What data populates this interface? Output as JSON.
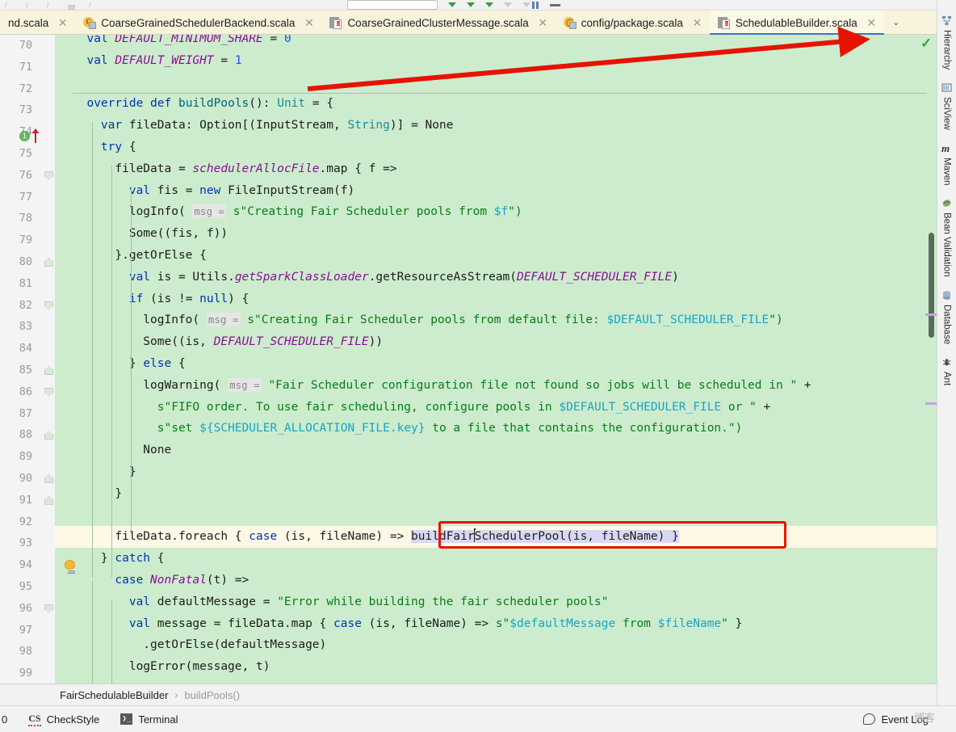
{
  "window": {
    "title": "SchedulableBuilder.scala"
  },
  "toolbar": {
    "search_placeholder": ""
  },
  "tabs": [
    {
      "label": "nd.scala",
      "icon": "scala-file-icon",
      "active": false,
      "truncated": true
    },
    {
      "label": "CoarseGrainedSchedulerBackend.scala",
      "icon": "scala-class-icon",
      "active": false
    },
    {
      "label": "CoarseGrainedClusterMessage.scala",
      "icon": "scala-file-icon",
      "active": false
    },
    {
      "label": "config/package.scala",
      "icon": "scala-package-icon",
      "active": false
    },
    {
      "label": "SchedulableBuilder.scala",
      "icon": "scala-file-icon",
      "active": true
    }
  ],
  "tab_overflow_label": "⌄",
  "editor": {
    "first_line": 70,
    "highlighted_line": 93,
    "caret_line": 93,
    "lines": [
      {
        "n": 70,
        "clipped": true,
        "tokens": [
          {
            "t": "  ",
            "c": ""
          },
          {
            "t": "val",
            "c": "kw"
          },
          {
            "t": " ",
            "c": ""
          },
          {
            "t": "DEFAULT_MINIMUM_SHARE",
            "c": "const"
          },
          {
            "t": " = ",
            "c": ""
          },
          {
            "t": "0",
            "c": "num"
          }
        ]
      },
      {
        "n": 71,
        "tokens": [
          {
            "t": "  ",
            "c": ""
          },
          {
            "t": "val",
            "c": "kw"
          },
          {
            "t": " ",
            "c": ""
          },
          {
            "t": "DEFAULT_WEIGHT",
            "c": "const"
          },
          {
            "t": " = ",
            "c": ""
          },
          {
            "t": "1",
            "c": "num"
          }
        ]
      },
      {
        "n": 72,
        "tokens": []
      },
      {
        "n": 73,
        "sep": true,
        "marker": "override-marker",
        "tokens": [
          {
            "t": "  ",
            "c": ""
          },
          {
            "t": "override",
            "c": "kw"
          },
          {
            "t": " ",
            "c": ""
          },
          {
            "t": "def",
            "c": "kw"
          },
          {
            "t": " ",
            "c": ""
          },
          {
            "t": "buildPools",
            "c": "fn"
          },
          {
            "t": "(): ",
            "c": ""
          },
          {
            "t": "Unit",
            "c": "type"
          },
          {
            "t": " = {",
            "c": ""
          }
        ]
      },
      {
        "n": 74,
        "tokens": [
          {
            "t": "    ",
            "c": ""
          },
          {
            "t": "var",
            "c": "kw"
          },
          {
            "t": " fileData: Option[(InputStream, ",
            "c": ""
          },
          {
            "t": "String",
            "c": "type"
          },
          {
            "t": ")] = None",
            "c": ""
          }
        ]
      },
      {
        "n": 75,
        "tokens": [
          {
            "t": "    ",
            "c": ""
          },
          {
            "t": "try",
            "c": "kw"
          },
          {
            "t": " {",
            "c": ""
          }
        ]
      },
      {
        "n": 76,
        "fold": "down",
        "tokens": [
          {
            "t": "      fileData = ",
            "c": ""
          },
          {
            "t": "schedulerAllocFile",
            "c": "italicv"
          },
          {
            "t": ".map { f =>",
            "c": ""
          }
        ]
      },
      {
        "n": 77,
        "tokens": [
          {
            "t": "        ",
            "c": ""
          },
          {
            "t": "val",
            "c": "kw"
          },
          {
            "t": " fis = ",
            "c": ""
          },
          {
            "t": "new",
            "c": "kw"
          },
          {
            "t": " FileInputStream(f)",
            "c": ""
          }
        ]
      },
      {
        "n": 78,
        "tokens": [
          {
            "t": "        logInfo( ",
            "c": ""
          },
          {
            "t": "msg =",
            "c": "hint"
          },
          {
            "t": " ",
            "c": ""
          },
          {
            "t": "s\"Creating Fair Scheduler pools from ",
            "c": "str"
          },
          {
            "t": "$f",
            "c": "dollar"
          },
          {
            "t": "\")",
            "c": "str"
          }
        ]
      },
      {
        "n": 79,
        "tokens": [
          {
            "t": "        Some((fis, f))",
            "c": ""
          }
        ]
      },
      {
        "n": 80,
        "fold": "up",
        "tokens": [
          {
            "t": "      }.getOrElse {",
            "c": ""
          }
        ]
      },
      {
        "n": 81,
        "tokens": [
          {
            "t": "        ",
            "c": ""
          },
          {
            "t": "val",
            "c": "kw"
          },
          {
            "t": " is = Utils.",
            "c": ""
          },
          {
            "t": "getSparkClassLoader",
            "c": "italicv"
          },
          {
            "t": ".getResourceAsStream(",
            "c": ""
          },
          {
            "t": "DEFAULT_SCHEDULER_FILE",
            "c": "const"
          },
          {
            "t": ")",
            "c": ""
          }
        ]
      },
      {
        "n": 82,
        "fold": "down",
        "tokens": [
          {
            "t": "        ",
            "c": ""
          },
          {
            "t": "if",
            "c": "kw"
          },
          {
            "t": " (is != ",
            "c": ""
          },
          {
            "t": "null",
            "c": "kw"
          },
          {
            "t": ") {",
            "c": ""
          }
        ]
      },
      {
        "n": 83,
        "tokens": [
          {
            "t": "          logInfo( ",
            "c": ""
          },
          {
            "t": "msg =",
            "c": "hint"
          },
          {
            "t": " ",
            "c": ""
          },
          {
            "t": "s\"Creating Fair Scheduler pools from default file: ",
            "c": "str"
          },
          {
            "t": "$DEFAULT_SCHEDULER_FILE",
            "c": "dollar"
          },
          {
            "t": "\")",
            "c": "str"
          }
        ]
      },
      {
        "n": 84,
        "tokens": [
          {
            "t": "          Some((is, ",
            "c": ""
          },
          {
            "t": "DEFAULT_SCHEDULER_FILE",
            "c": "const"
          },
          {
            "t": "))",
            "c": ""
          }
        ]
      },
      {
        "n": 85,
        "fold": "up",
        "tokens": [
          {
            "t": "        } ",
            "c": ""
          },
          {
            "t": "else",
            "c": "kw"
          },
          {
            "t": " {",
            "c": ""
          }
        ]
      },
      {
        "n": 86,
        "fold": "down",
        "tokens": [
          {
            "t": "          logWarning( ",
            "c": ""
          },
          {
            "t": "msg =",
            "c": "hint"
          },
          {
            "t": " ",
            "c": ""
          },
          {
            "t": "\"Fair Scheduler configuration file not found so jobs will be scheduled in \"",
            "c": "str"
          },
          {
            "t": " +",
            "c": ""
          }
        ]
      },
      {
        "n": 87,
        "tokens": [
          {
            "t": "            ",
            "c": ""
          },
          {
            "t": "s\"FIFO order. To use fair scheduling, configure pools in ",
            "c": "str"
          },
          {
            "t": "$DEFAULT_SCHEDULER_FILE",
            "c": "dollar"
          },
          {
            "t": " or \"",
            "c": "str"
          },
          {
            "t": " +",
            "c": ""
          }
        ]
      },
      {
        "n": 88,
        "fold": "up",
        "tokens": [
          {
            "t": "            ",
            "c": ""
          },
          {
            "t": "s\"set ",
            "c": "str"
          },
          {
            "t": "${SCHEDULER_ALLOCATION_FILE.key}",
            "c": "dollar"
          },
          {
            "t": " to a file that contains the configuration.\")",
            "c": "str"
          }
        ]
      },
      {
        "n": 89,
        "tokens": [
          {
            "t": "          None",
            "c": ""
          }
        ]
      },
      {
        "n": 90,
        "fold": "up",
        "tokens": [
          {
            "t": "        }",
            "c": ""
          }
        ]
      },
      {
        "n": 91,
        "fold": "up",
        "tokens": [
          {
            "t": "      }",
            "c": ""
          }
        ]
      },
      {
        "n": 92,
        "tokens": []
      },
      {
        "n": 93,
        "highlight": true,
        "bulb": true,
        "tokens": [
          {
            "t": "      fileData.foreach { ",
            "c": ""
          },
          {
            "t": "case",
            "c": "kw"
          },
          {
            "t": " (is, fileName) => ",
            "c": ""
          },
          {
            "t": "buildFair",
            "c": "sel"
          },
          {
            "t": "CARET",
            "c": "caret"
          },
          {
            "t": "SchedulerPool(is, fileName) }",
            "c": "sel"
          }
        ]
      },
      {
        "n": 94,
        "tokens": [
          {
            "t": "    } ",
            "c": ""
          },
          {
            "t": "catch",
            "c": "kw"
          },
          {
            "t": " {",
            "c": ""
          }
        ]
      },
      {
        "n": 95,
        "tokens": [
          {
            "t": "      ",
            "c": ""
          },
          {
            "t": "case",
            "c": "kw"
          },
          {
            "t": " ",
            "c": ""
          },
          {
            "t": "NonFatal",
            "c": "italicv"
          },
          {
            "t": "(t) =>",
            "c": ""
          }
        ]
      },
      {
        "n": 96,
        "fold": "down",
        "tokens": [
          {
            "t": "        ",
            "c": ""
          },
          {
            "t": "val",
            "c": "kw"
          },
          {
            "t": " defaultMessage = ",
            "c": ""
          },
          {
            "t": "\"Error while building the fair scheduler pools\"",
            "c": "str"
          }
        ]
      },
      {
        "n": 97,
        "tokens": [
          {
            "t": "        ",
            "c": ""
          },
          {
            "t": "val",
            "c": "kw"
          },
          {
            "t": " message = fileData.map { ",
            "c": ""
          },
          {
            "t": "case",
            "c": "kw"
          },
          {
            "t": " (is, fileName) => ",
            "c": ""
          },
          {
            "t": "s\"",
            "c": "str"
          },
          {
            "t": "$defaultMessage",
            "c": "dollar"
          },
          {
            "t": " from ",
            "c": "str"
          },
          {
            "t": "$fileName",
            "c": "dollar"
          },
          {
            "t": "\"",
            "c": "str"
          },
          {
            "t": " }",
            "c": ""
          }
        ]
      },
      {
        "n": 98,
        "tokens": [
          {
            "t": "          .getOrElse(defaultMessage)",
            "c": ""
          }
        ]
      },
      {
        "n": 99,
        "tokens": [
          {
            "t": "        logError(message, t)",
            "c": ""
          }
        ]
      }
    ]
  },
  "right_sidebar": [
    {
      "label": "Hierarchy",
      "icon": "hierarchy-icon"
    },
    {
      "label": "SciView",
      "icon": "sciview-icon"
    },
    {
      "label": "Maven",
      "icon": "maven-icon"
    },
    {
      "label": "Bean Validation",
      "icon": "bean-validation-icon"
    },
    {
      "label": "Database",
      "icon": "database-icon"
    },
    {
      "label": "Ant",
      "icon": "ant-icon"
    }
  ],
  "breadcrumb": {
    "class": "FairSchedulableBuilder",
    "separator": "›",
    "method": "buildPools()"
  },
  "statusbar": {
    "leading_fragment": "0",
    "checkstyle": "CheckStyle",
    "checkstyle_icon_text": "CS",
    "terminal": "Terminal",
    "terminal_icon_text": "❯_",
    "event_log": "Event Log"
  },
  "watermark": "博客",
  "annotations": {
    "arrow_color": "#e51400",
    "box_color": "#e51400",
    "box_label": "buildFairSchedulerPool(is, fileName) }"
  },
  "colors": {
    "editor_background": "#cdeccd",
    "highlight_line": "#fdf9e6",
    "tabbar_background": "#f7f3dd",
    "active_tab_underline": "#3a75c4",
    "keyword": "#0033b3",
    "string": "#067d17",
    "constant": "#871094",
    "number": "#1750eb",
    "type": "#1a8a9e",
    "function": "#00627a"
  }
}
